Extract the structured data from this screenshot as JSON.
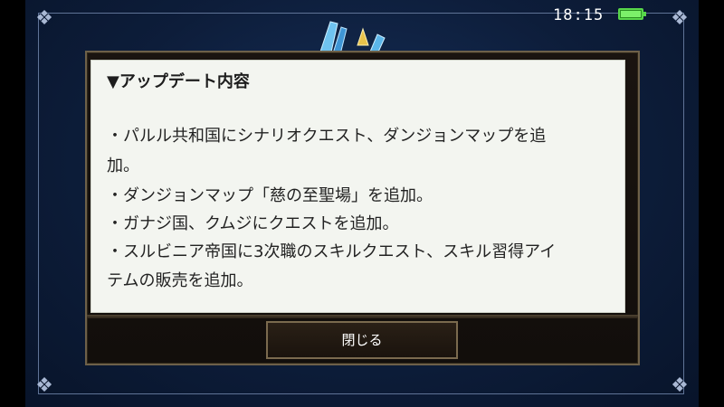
{
  "status_bar": {
    "time": "18:15",
    "battery_level": 1.0,
    "battery_color": "#58d64a"
  },
  "dialog": {
    "title": "▼アップデート内容",
    "lines": [
      "・パルル共和国にシナリオクエスト、ダンジョンマップを追",
      "加。",
      "・ダンジョンマップ「慈の至聖場」を追加。",
      "・ガナジ国、クムジにクエストを追加。",
      "・スルビニア帝国に3次職のスキルクエスト、スキル習得アイ",
      "テムの販売を追加。"
    ],
    "close_label": "閉じる"
  },
  "colors": {
    "background": "#0d1d3a",
    "panel": "#1a1410",
    "panel_border": "#6d6049",
    "content_bg": "#f3f5f0",
    "text": "#222222"
  },
  "icons": {
    "crystal": "crystal-emblem-icon",
    "corner": "ornament-corner-icon",
    "battery": "battery-icon"
  }
}
